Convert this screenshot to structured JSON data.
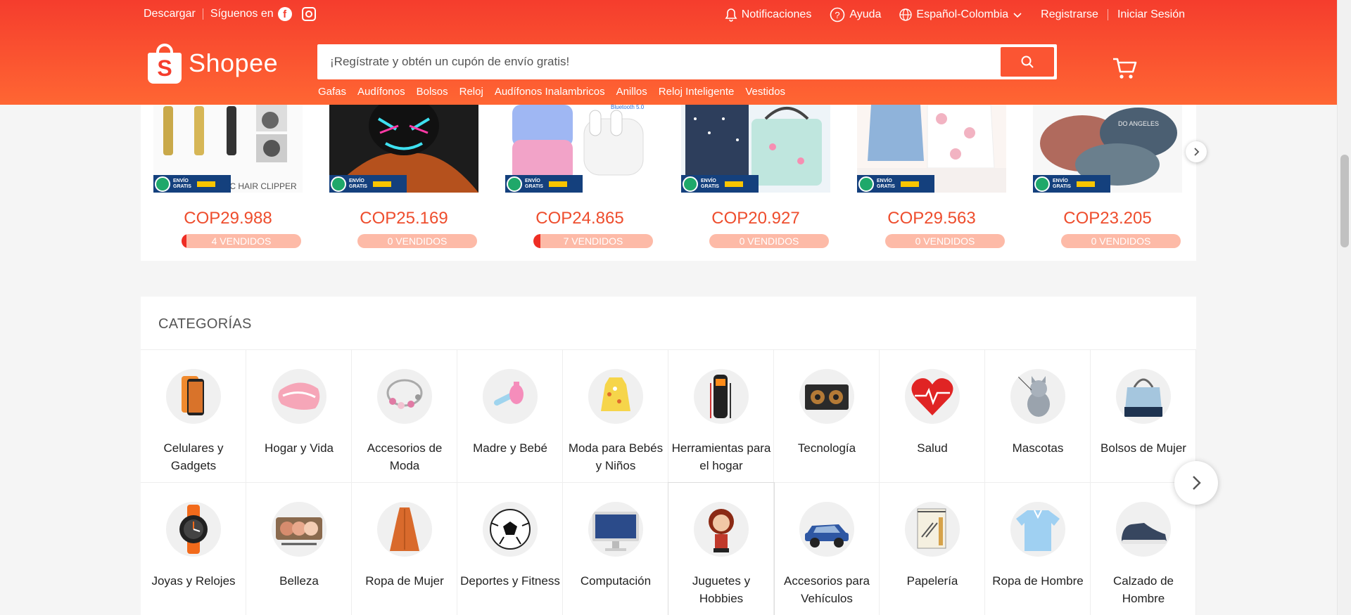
{
  "topbar": {
    "download": "Descargar",
    "follow": "Síguenos en",
    "notifications": "Notificaciones",
    "help": "Ayuda",
    "language": "Español-Colombia",
    "register": "Registrarse",
    "login": "Iniciar Sesión"
  },
  "logo": {
    "letter": "S",
    "name": "Shopee"
  },
  "search": {
    "placeholder": "¡Regístrate y obtén un cupón de envío gratis!"
  },
  "keywords": [
    "Gafas",
    "Audífonos",
    "Bolsos",
    "Reloj",
    "Audífonos Inalambricos",
    "Anillos",
    "Reloj Inteligente",
    "Vestidos"
  ],
  "products": [
    {
      "currency": "COP",
      "price": "29.988",
      "sold": "4 VENDIDOS",
      "sold_fraction": 0.04,
      "img": "clipper"
    },
    {
      "currency": "COP",
      "price": "25.169",
      "sold": "0 VENDIDOS",
      "sold_fraction": 0,
      "img": "mask"
    },
    {
      "currency": "COP",
      "price": "24.865",
      "sold": "7 VENDIDOS",
      "sold_fraction": 0.06,
      "img": "earbuds"
    },
    {
      "currency": "COP",
      "price": "20.927",
      "sold": "0 VENDIDOS",
      "sold_fraction": 0,
      "img": "bags"
    },
    {
      "currency": "COP",
      "price": "29.563",
      "sold": "0 VENDIDOS",
      "sold_fraction": 0,
      "img": "clothes"
    },
    {
      "currency": "COP",
      "price": "23.205",
      "sold": "0 VENDIDOS",
      "sold_fraction": 0,
      "img": "caps"
    }
  ],
  "badge": {
    "line1": "ENVÍO",
    "line2": "GRATIS"
  },
  "categories": {
    "title": "CATEGORÍAS",
    "items": [
      {
        "name": "Celulares y Gadgets",
        "icon": "phone-icon"
      },
      {
        "name": "Hogar y Vida",
        "icon": "pillow-icon"
      },
      {
        "name": "Accesorios de Moda",
        "icon": "bracelet-icon"
      },
      {
        "name": "Madre y Bebé",
        "icon": "nasal-aspirator-icon"
      },
      {
        "name": "Moda para Bebés y Niños",
        "icon": "baby-dress-icon"
      },
      {
        "name": "Herramientas para el hogar",
        "icon": "multimeter-icon"
      },
      {
        "name": "Tecnología",
        "icon": "speaker-icon"
      },
      {
        "name": "Salud",
        "icon": "heart-icon"
      },
      {
        "name": "Mascotas",
        "icon": "cat-icon"
      },
      {
        "name": "Bolsos de Mujer",
        "icon": "handbag-icon"
      },
      {
        "name": "Joyas y Relojes",
        "icon": "watch-icon"
      },
      {
        "name": "Belleza",
        "icon": "eyeshadow-palette-icon"
      },
      {
        "name": "Ropa de Mujer",
        "icon": "dress-icon"
      },
      {
        "name": "Deportes y Fitness",
        "icon": "soccer-ball-icon"
      },
      {
        "name": "Computación",
        "icon": "monitor-icon"
      },
      {
        "name": "Juguetes y Hobbies",
        "icon": "figure-icon"
      },
      {
        "name": "Accesorios para Vehículos",
        "icon": "car-icon"
      },
      {
        "name": "Papelería",
        "icon": "notebook-icon"
      },
      {
        "name": "Ropa de Hombre",
        "icon": "polo-shirt-icon"
      },
      {
        "name": "Calzado de Hombre",
        "icon": "sneaker-icon"
      }
    ]
  },
  "colors": {
    "brand": "#ee4d2d",
    "header_top": "#f53d2d",
    "header_bottom": "#ff6633"
  }
}
